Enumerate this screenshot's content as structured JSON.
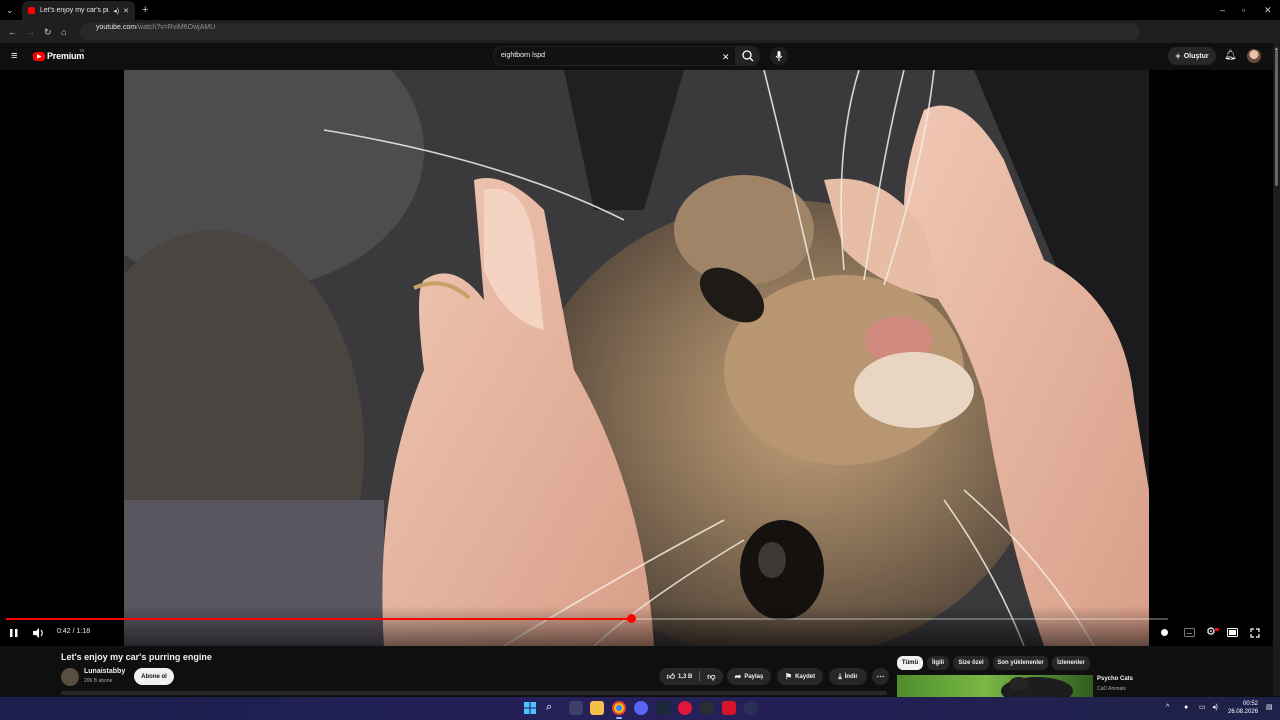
{
  "browser": {
    "tab": {
      "title": "Let's enjoy my car's purring engine"
    },
    "address": {
      "host": "youtube.com",
      "path": "/watch?v=RviM6OwjAMU"
    }
  },
  "youtube": {
    "logo_text": "Premium",
    "logo_sup": "TR",
    "search": {
      "value": "eightborn lspd"
    },
    "create_label": "Oluştur"
  },
  "player": {
    "time_current": "0:42",
    "time_total": "1:18",
    "time_display": "0:42 / 1:18",
    "progress_fraction": 0.538,
    "is_playing": true
  },
  "video": {
    "title": "Let's enjoy my car's purring engine",
    "channel": "Lunaistabby",
    "subscribers": "206 B abone",
    "subscribe_label": "Abone ol",
    "like_count": "1,3 B",
    "share_label": "Paylaş",
    "save_label": "Kaydet",
    "download_label": "İndir"
  },
  "chips": [
    "Tümü",
    "İlgili",
    "Size özel",
    "Son yüklenenler",
    "İzlenenler"
  ],
  "recommended": {
    "title": "Psycho Cats",
    "channel": "CaD Animals"
  },
  "taskbar": {
    "time": "00:52",
    "date": "26.08.2026"
  },
  "colors": {
    "accent": "#ff0000",
    "background": "#0f0f0f",
    "chip_active": "#f1f1f1"
  }
}
